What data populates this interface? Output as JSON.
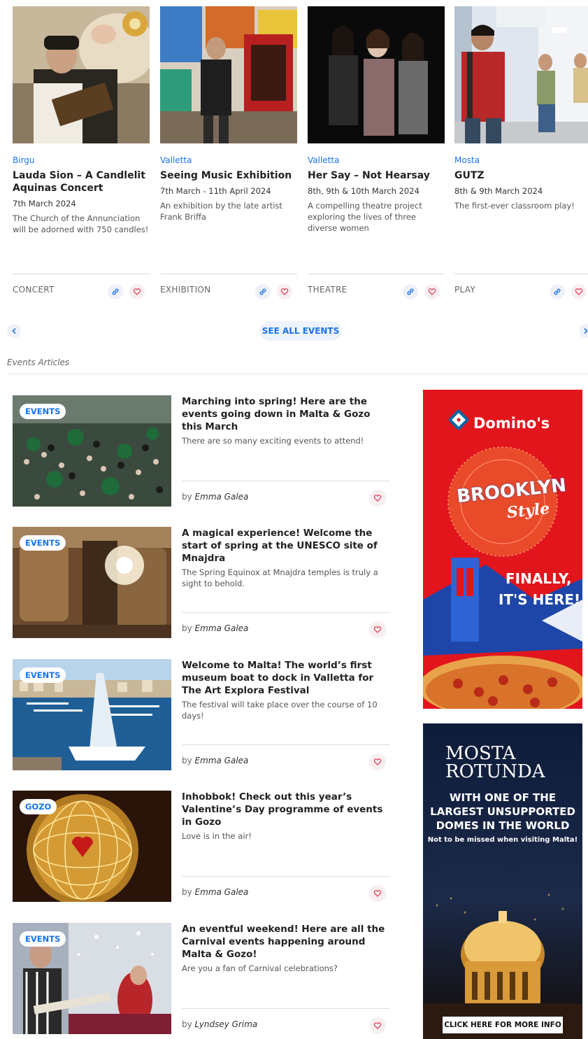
{
  "events": [
    {
      "location": "Birgu",
      "title": "Lauda Sion – A Candlelit Aquinas Concert",
      "date": "7th March 2024",
      "desc": "The Church of the Annunciation will be adorned with 750 candles!",
      "category": "CONCERT"
    },
    {
      "location": "Valletta",
      "title": "Seeing Music Exhibition",
      "date": "7th March - 11th April 2024",
      "desc": "An exhibition by the late artist Frank Briffa",
      "category": "EXHIBITION"
    },
    {
      "location": "Valletta",
      "title": "Her Say – Not Hearsay",
      "date": "8th, 9th & 10th March 2024",
      "desc": "A compelling theatre project exploring the lives of three diverse women",
      "category": "THEATRE"
    },
    {
      "location": "Mosta",
      "title": "GUTZ",
      "date": "8th & 9th March 2024",
      "desc": "The first-ever classroom play!",
      "category": "PLAY"
    }
  ],
  "nav": {
    "see_all": "SEE ALL EVENTS"
  },
  "section_title": "Events Articles",
  "articles": [
    {
      "tag": "EVENTS",
      "title": "Marching into spring! Here are the events going down in Malta & Gozo this March",
      "desc": "There are so many exciting events to attend!",
      "by": "by",
      "author": "Emma Galea"
    },
    {
      "tag": "EVENTS",
      "title": "A magical experience! Welcome the start of spring at the UNESCO site of Mnajdra",
      "desc": "The Spring Equinox at Mnajdra temples is truly a sight to behold.",
      "by": "by",
      "author": "Emma Galea"
    },
    {
      "tag": "EVENTS",
      "title": "Welcome to Malta! The world’s first museum boat to dock in Valletta for The Art Explora Festival",
      "desc": "The festival will take place over the course of 10 days!",
      "by": "by",
      "author": "Emma Galea"
    },
    {
      "tag": "GOZO",
      "title": "Inhobbok! Check out this year’s Valentine’s Day programme of events in Gozo",
      "desc": "Love is in the air!",
      "by": "by",
      "author": "Emma Galea"
    },
    {
      "tag": "EVENTS",
      "title": "An eventful weekend! Here are all the Carnival events happening around Malta & Gozo!",
      "desc": "Are you a fan of Carnival celebrations?",
      "by": "by",
      "author": "Lyndsey Grima"
    }
  ],
  "ads": {
    "dominos": {
      "brand": "Domino's",
      "circle_line1": "BROOKLYN",
      "circle_line2": "Style",
      "headline1": "FINALLY,",
      "headline2": "IT'S HERE!"
    },
    "mosta": {
      "logo1": "MOSTA",
      "logo2": "ROTUNDA",
      "headline1": "WITH ONE OF THE",
      "headline2": "LARGEST UNSUPPORTED",
      "headline3": "DOMES IN THE WORLD",
      "sub": "Not to be missed when visiting Malta!",
      "cta": "CLICK HERE FOR MORE INFO"
    }
  },
  "colors": {
    "accent": "#1a73e8",
    "heart": "#e0445a",
    "dominos_red": "#e2151d",
    "mosta_navy": "#0f1e3d"
  }
}
